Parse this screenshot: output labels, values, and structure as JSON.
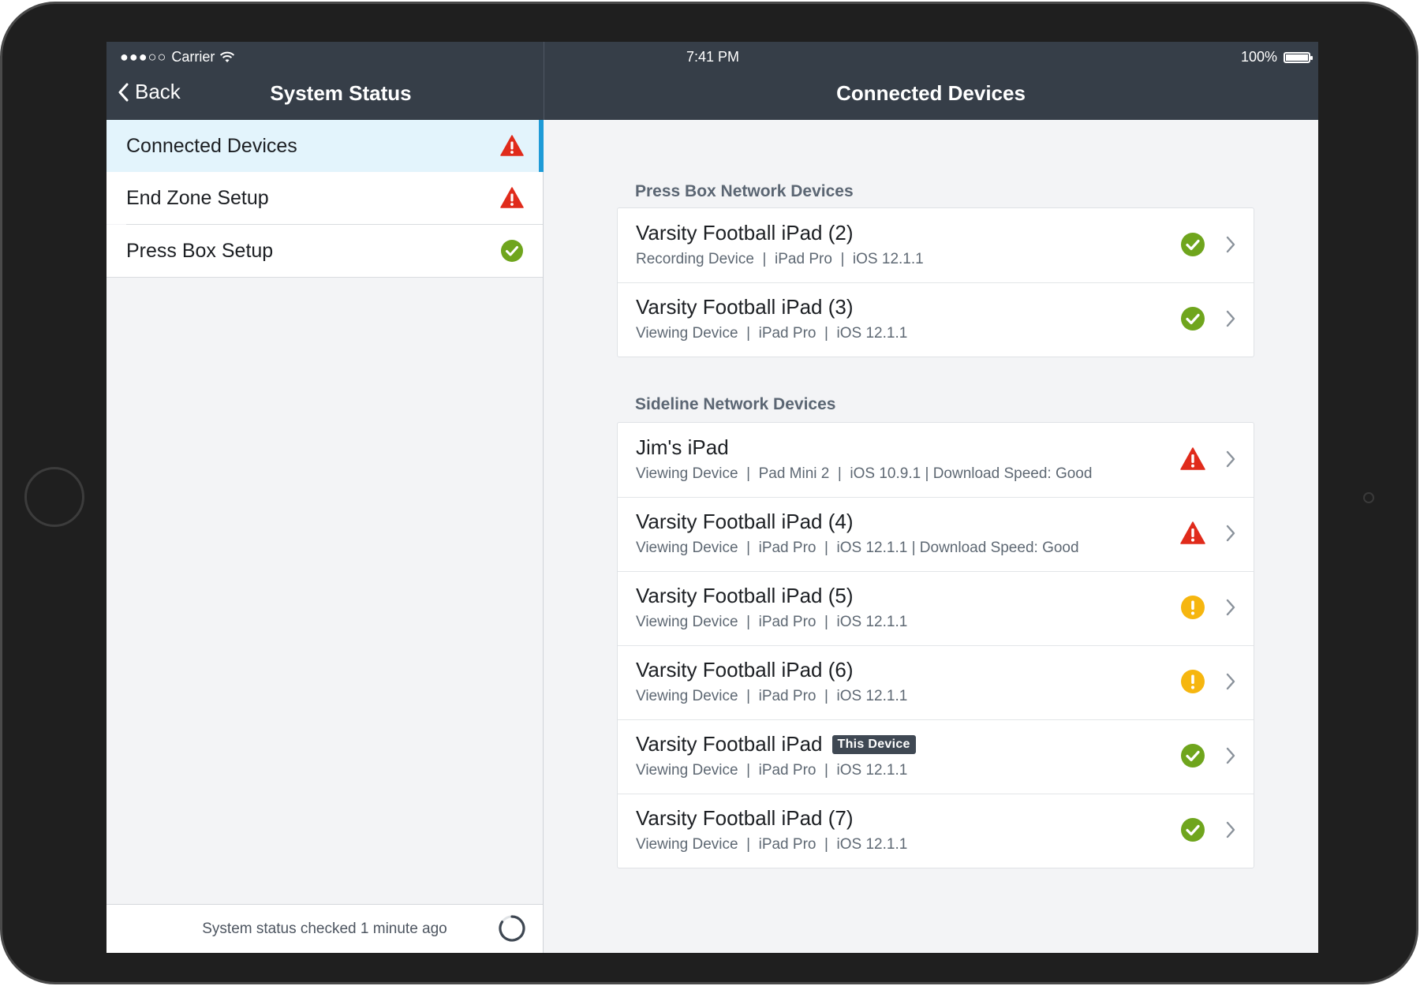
{
  "status_bar": {
    "carrier": "Carrier",
    "time": "7:41 PM",
    "battery": "100%"
  },
  "header": {
    "back_label": "Back",
    "left_title": "System Status",
    "right_title": "Connected Devices"
  },
  "sidebar": {
    "items": [
      {
        "label": "Connected Devices",
        "status": "error"
      },
      {
        "label": "End Zone Setup",
        "status": "error"
      },
      {
        "label": "Press Box Setup",
        "status": "ok"
      }
    ],
    "footer_text": "System status checked 1 minute ago"
  },
  "sections": [
    {
      "title": "Press Box Network Devices",
      "devices": [
        {
          "name": "Varsity Football iPad (2)",
          "detail": "Recording Device  |  iPad Pro  |  iOS 12.1.1",
          "status": "ok"
        },
        {
          "name": "Varsity Football iPad (3)",
          "detail": "Viewing Device  |  iPad Pro  |  iOS 12.1.1",
          "status": "ok"
        }
      ]
    },
    {
      "title": "Sideline Network Devices",
      "devices": [
        {
          "name": "Jim's iPad",
          "detail": "Viewing Device  |  Pad Mini 2  |  iOS 10.9.1 | Download Speed: Good",
          "status": "error"
        },
        {
          "name": "Varsity Football iPad (4)",
          "detail": "Viewing Device  |  iPad Pro  |  iOS 12.1.1 | Download Speed: Good",
          "status": "error"
        },
        {
          "name": "Varsity Football iPad (5)",
          "detail": "Viewing Device  |  iPad Pro  |  iOS 12.1.1",
          "status": "warning"
        },
        {
          "name": "Varsity Football iPad (6)",
          "detail": "Viewing Device  |  iPad Pro  |  iOS 12.1.1",
          "status": "warning"
        },
        {
          "name": "Varsity Football iPad",
          "badge": "This Device",
          "detail": "Viewing Device  |  iPad Pro  |  iOS 12.1.1",
          "status": "ok"
        },
        {
          "name": "Varsity Football iPad (7)",
          "detail": "Viewing Device  |  iPad Pro  |  iOS 12.1.1",
          "status": "ok"
        }
      ]
    }
  ],
  "colors": {
    "header_bg": "#363e48",
    "accent": "#1e9bd7",
    "ok": "#6fa51d",
    "error": "#e02b1b",
    "warning": "#f6b60f",
    "active_row": "#e3f4fc"
  }
}
